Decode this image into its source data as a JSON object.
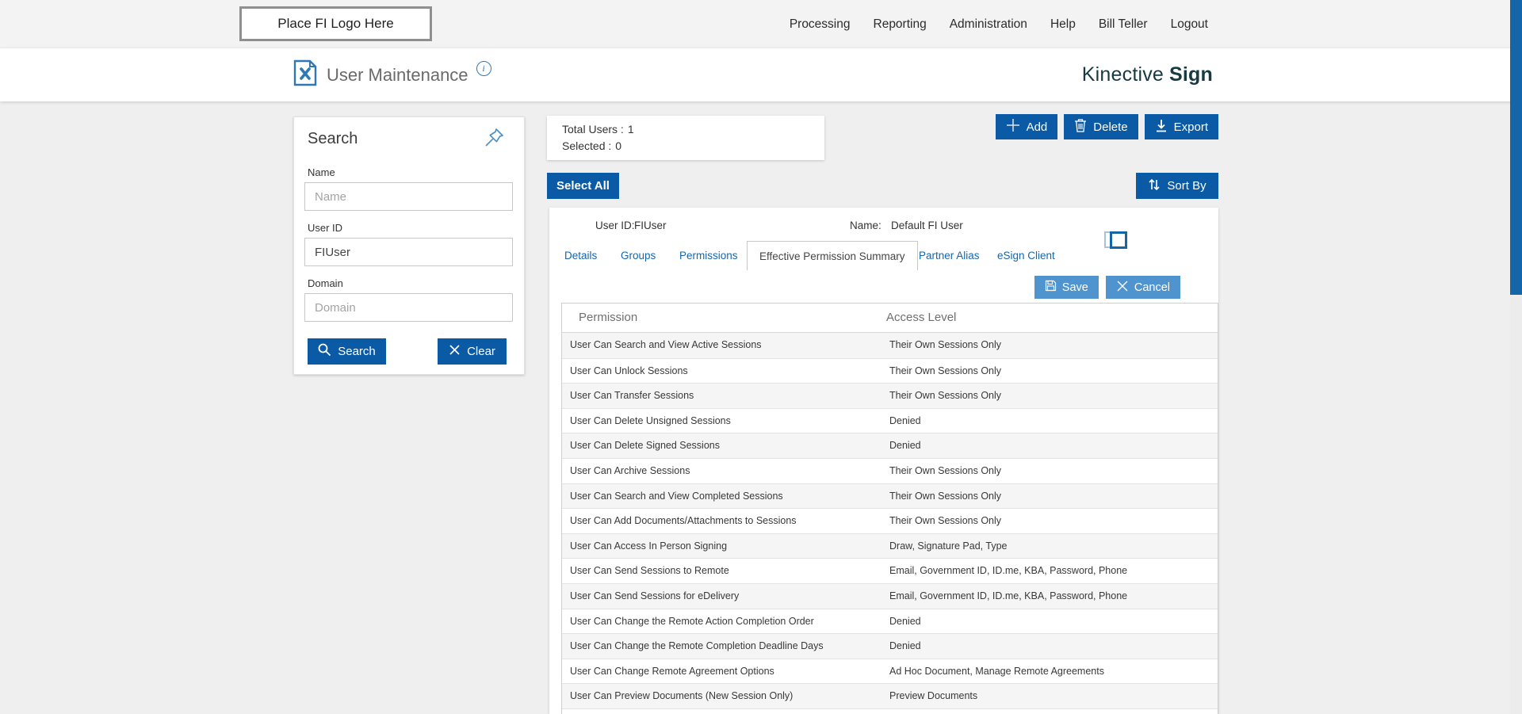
{
  "topbar": {
    "logo_placeholder": "Place FI Logo Here",
    "nav": [
      "Processing",
      "Reporting",
      "Administration",
      "Help",
      "Bill Teller",
      "Logout"
    ]
  },
  "header": {
    "title": "User Maintenance",
    "info_glyph": "i",
    "brand_name": "Kinective",
    "brand_product": "Sign"
  },
  "search_panel": {
    "title": "Search",
    "fields": [
      {
        "label": "Name",
        "placeholder": "Name",
        "value": ""
      },
      {
        "label": "User ID",
        "placeholder": "",
        "value": "FIUser"
      },
      {
        "label": "Domain",
        "placeholder": "Domain",
        "value": ""
      }
    ],
    "buttons": {
      "search": "Search",
      "clear": "Clear"
    }
  },
  "summary": {
    "total_users_label": "Total Users :",
    "total_users_value": "1",
    "selected_label": "Selected :",
    "selected_value": "0"
  },
  "toolbar": {
    "add": "Add",
    "delete": "Delete",
    "export": "Export",
    "select_all": "Select All",
    "sort_by": "Sort By"
  },
  "user_card": {
    "user_id_label": "User ID:",
    "user_id_value": "FIUser",
    "name_label": "Name:",
    "name_value": "Default FI User",
    "tabs": [
      {
        "label": "Details",
        "active": false
      },
      {
        "label": "Groups",
        "active": false
      },
      {
        "label": "Permissions",
        "active": false
      },
      {
        "label": "Effective Permission Summary",
        "active": true
      },
      {
        "label": "Partner Alias",
        "active": false
      },
      {
        "label": "eSign Client",
        "active": false
      }
    ],
    "save": "Save",
    "cancel": "Cancel"
  },
  "permissions_table": {
    "columns": [
      "Permission",
      "Access Level"
    ],
    "rows": [
      [
        "User Can Search and View Active Sessions",
        "Their Own Sessions Only"
      ],
      [
        "User Can Unlock Sessions",
        "Their Own Sessions Only"
      ],
      [
        "User Can Transfer Sessions",
        "Their Own Sessions Only"
      ],
      [
        "User Can Delete Unsigned Sessions",
        "Denied"
      ],
      [
        "User Can Delete Signed Sessions",
        "Denied"
      ],
      [
        "User Can Archive Sessions",
        "Their Own Sessions Only"
      ],
      [
        "User Can Search and View Completed Sessions",
        "Their Own Sessions Only"
      ],
      [
        "User Can Add Documents/Attachments to Sessions",
        "Their Own Sessions Only"
      ],
      [
        "User Can Access In Person Signing",
        "Draw, Signature Pad, Type"
      ],
      [
        "User Can Send Sessions to Remote",
        "Email, Government ID, ID.me, KBA, Password, Phone"
      ],
      [
        "User Can Send Sessions for eDelivery",
        "Email, Government ID, ID.me, KBA, Password, Phone"
      ],
      [
        "User Can Change the Remote Action Completion Order",
        "Denied"
      ],
      [
        "User Can Change the Remote Completion Deadline Days",
        "Denied"
      ],
      [
        "User Can Change Remote Agreement Options",
        "Ad Hoc Document, Manage Remote Agreements"
      ],
      [
        "User Can Preview Documents (New Session Only)",
        "Preview Documents"
      ]
    ]
  },
  "colors": {
    "primary_blue": "#0b5aa5",
    "light_blue": "#4f94ce",
    "tab_link_blue": "#1566ad",
    "brand_teal": "#173a43",
    "topbar_bg": "#f3f3f3",
    "content_bg": "#efefef",
    "row_alt_gray": "#f5f5f5",
    "scrollbar_thumb_blue": "#1566a8"
  }
}
